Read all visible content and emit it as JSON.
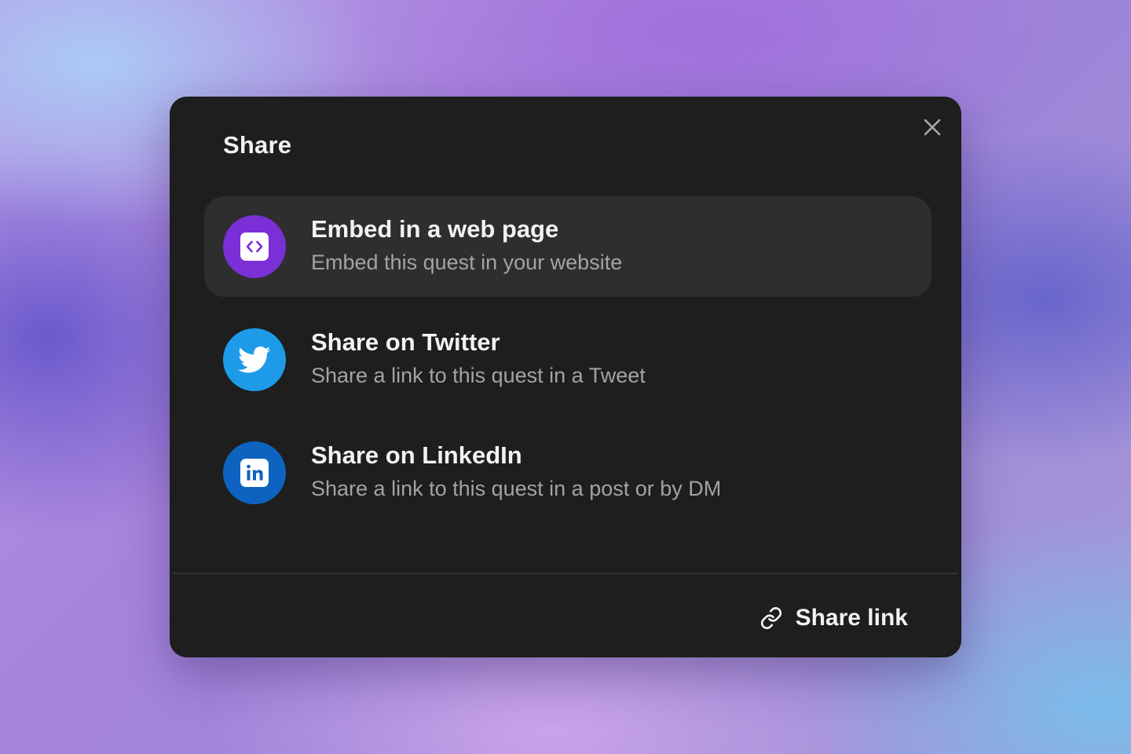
{
  "modal": {
    "title": "Share",
    "close_icon": "close-icon"
  },
  "options": [
    {
      "title": "Embed in a web page",
      "subtitle": "Embed this quest in your website",
      "icon": "code-embed-icon",
      "icon_bg": "#7b2fd6",
      "highlighted": true
    },
    {
      "title": "Share on Twitter",
      "subtitle": "Share a link to this quest in a Tweet",
      "icon": "twitter-bird-icon",
      "icon_bg": "#1d9be9",
      "highlighted": false
    },
    {
      "title": "Share on LinkedIn",
      "subtitle": "Share a link to this quest in a post or by DM",
      "icon": "linkedin-icon",
      "icon_bg": "#0e63c0",
      "highlighted": false
    }
  ],
  "footer": {
    "share_link_label": "Share link",
    "share_link_icon": "link-icon"
  },
  "colors": {
    "modal_bg": "#1e1e1e",
    "highlight_bg": "#2e2e2e",
    "text_primary": "#f2f2f2",
    "text_secondary": "#a3a3a3"
  }
}
